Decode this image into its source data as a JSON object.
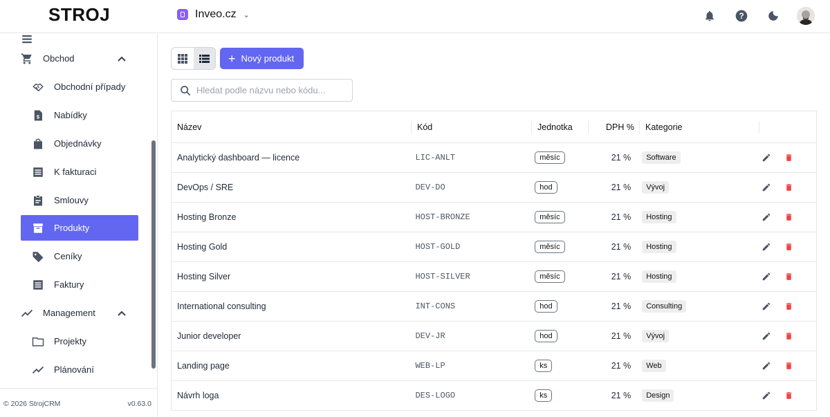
{
  "header": {
    "logo": "STROJ",
    "org_name": "Inveo.cz",
    "icons": [
      "bell-icon",
      "help-icon",
      "dark-mode-icon",
      "avatar"
    ]
  },
  "sidebar": {
    "section_obchod": "Obchod",
    "items_obchod": [
      {
        "label": "Obchodní případy",
        "icon": "handshake-icon"
      },
      {
        "label": "Nabídky",
        "icon": "document-dollar-icon"
      },
      {
        "label": "Objednávky",
        "icon": "shopping-bag-icon"
      },
      {
        "label": "K fakturaci",
        "icon": "list-icon"
      },
      {
        "label": "Smlouvy",
        "icon": "clipboard-icon"
      },
      {
        "label": "Produkty",
        "icon": "archive-icon",
        "active": true
      },
      {
        "label": "Ceníky",
        "icon": "tag-icon"
      },
      {
        "label": "Faktury",
        "icon": "invoice-icon"
      }
    ],
    "section_management": "Management",
    "items_management": [
      {
        "label": "Projekty",
        "icon": "folder-icon"
      },
      {
        "label": "Plánování",
        "icon": "trend-icon"
      }
    ],
    "footer_copy": "© 2026 StrojCRM",
    "footer_version": "v0.63.0"
  },
  "toolbar": {
    "new_product_label": "Nový produkt",
    "search_placeholder": "Hledat podle názvu nebo kódu..."
  },
  "table": {
    "headers": {
      "name": "Název",
      "code": "Kód",
      "unit": "Jednotka",
      "vat": "DPH %",
      "category": "Kategorie"
    },
    "rows": [
      {
        "name": "Analytický dashboard — licence",
        "code": "LIC-ANLT",
        "unit": "měsíc",
        "vat": "21 %",
        "category": "Software"
      },
      {
        "name": "DevOps / SRE",
        "code": "DEV-DO",
        "unit": "hod",
        "vat": "21 %",
        "category": "Vývoj"
      },
      {
        "name": "Hosting Bronze",
        "code": "HOST-BRONZE",
        "unit": "měsíc",
        "vat": "21 %",
        "category": "Hosting"
      },
      {
        "name": "Hosting Gold",
        "code": "HOST-GOLD",
        "unit": "měsíc",
        "vat": "21 %",
        "category": "Hosting"
      },
      {
        "name": "Hosting Silver",
        "code": "HOST-SILVER",
        "unit": "měsíc",
        "vat": "21 %",
        "category": "Hosting"
      },
      {
        "name": "International consulting",
        "code": "INT-CONS",
        "unit": "hod",
        "vat": "21 %",
        "category": "Consulting"
      },
      {
        "name": "Junior developer",
        "code": "DEV-JR",
        "unit": "hod",
        "vat": "21 %",
        "category": "Vývoj"
      },
      {
        "name": "Landing page",
        "code": "WEB-LP",
        "unit": "ks",
        "vat": "21 %",
        "category": "Web"
      },
      {
        "name": "Návrh loga",
        "code": "DES-LOGO",
        "unit": "ks",
        "vat": "21 %",
        "category": "Design"
      }
    ]
  },
  "colors": {
    "accent": "#6366f1",
    "org_badge": "#8b5cf6",
    "delete": "#ef4444",
    "logo_gear": "#f97316"
  }
}
